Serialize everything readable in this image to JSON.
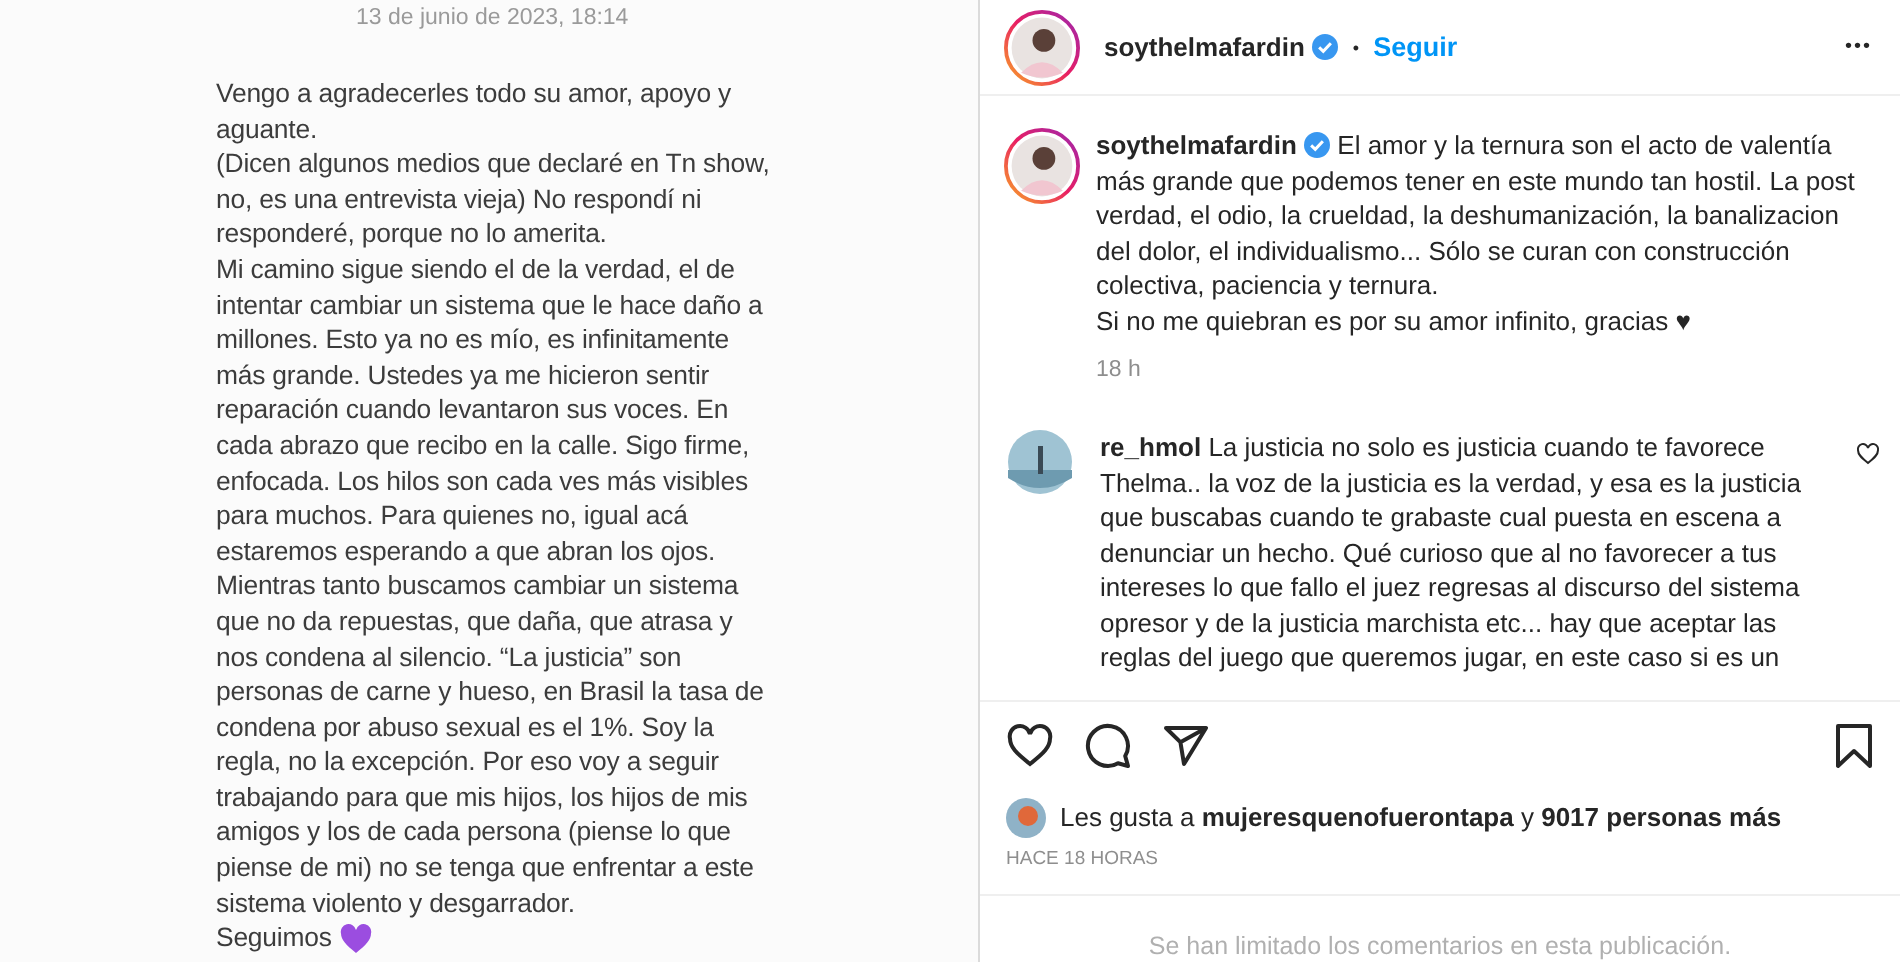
{
  "note": {
    "date": "13 de junio de 2023, 18:14",
    "lines": [
      "Vengo a agradecerles todo su amor, apoyo y",
      "aguante.",
      "(Dicen algunos medios que declaré en Tn show,",
      "no, es una entrevista vieja) No respondí ni",
      "responderé, porque no lo amerita.",
      "Mi camino sigue siendo el de la verdad, el de",
      "intentar cambiar un sistema que le hace daño a",
      "millones. Esto ya no es mío, es infinitamente",
      "más grande. Ustedes ya me hicieron sentir",
      "reparación cuando levantaron sus voces. En",
      "cada abrazo que recibo en la calle. Sigo firme,",
      "enfocada. Los hilos son cada ves más visibles",
      "para muchos. Para quienes no, igual acá",
      "estaremos esperando a que abran los ojos.",
      "Mientras tanto buscamos cambiar un sistema",
      "que no da repuestas, que daña, que atrasa y",
      "nos condena al silencio. “La justicia” son",
      "personas de carne y hueso, en Brasil la tasa de",
      "condena por abuso sexual es el 1%. Soy la",
      "regla, no la excepción. Por eso voy a seguir",
      "trabajando para que mis hijos, los hijos de mis",
      "amigos y los de cada persona (piense lo que",
      "piense de mi) no se tenga que enfrentar a este",
      "sistema violento y desgarrador.",
      "Seguimos"
    ]
  },
  "header": {
    "username": "soythelmafardin",
    "verified": true,
    "separator": "•",
    "follow": "Seguir",
    "menu": "•••"
  },
  "caption": {
    "username": "soythelmafardin",
    "verified": true,
    "text": "El amor y la ternura son el acto de valentía más grande que podemos tener en este mundo tan hostil. La post verdad, el odio, la crueldad, la deshumanización, la banalizacion del dolor, el individualismo... Sólo se curan con construcción colectiva, paciencia y ternura.",
    "text2": "Si no me quiebran es por su amor infinito, gracias ♥",
    "time": "18 h"
  },
  "comments": [
    {
      "username": "re_hmol",
      "text": "La justicia no solo es justicia cuando te favorece Thelma.. la voz de la justicia es la verdad, y esa es la justicia que buscabas cuando te grabaste cual puesta en escena a denunciar un hecho. Qué curioso que al no favorecer a tus intereses lo que fallo el juez regresas al discurso del sistema opresor y de la justicia marchista etc... hay que aceptar las reglas del juego que queremos jugar, en este caso si es un",
      "liked": false
    }
  ],
  "likes": {
    "prefix": "Les gusta a",
    "user": "mujeresquenofuerontapa",
    "mid": "y",
    "count": "9017 personas más"
  },
  "timestamp": "HACE 18 HORAS",
  "comments_limited": "Se han limitado los comentarios en esta publicación."
}
